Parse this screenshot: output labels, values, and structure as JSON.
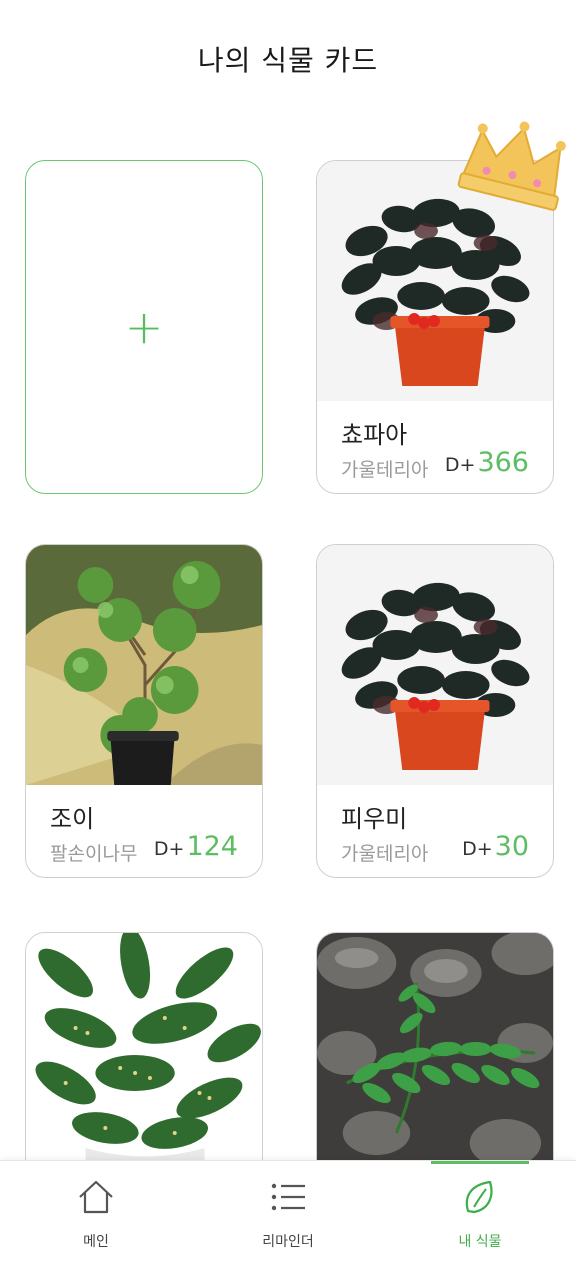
{
  "header": {
    "title": "나의 식물 카드"
  },
  "add_card": {
    "symbol": "+"
  },
  "plants": [
    {
      "nickname": "쵸파아",
      "species": "가울테리아",
      "dday_prefix": "D+",
      "dday_value": "366"
    },
    {
      "nickname": "조이",
      "species": "팔손이나무",
      "dday_prefix": "D+",
      "dday_value": "124"
    },
    {
      "nickname": "피우미",
      "species": "가울테리아",
      "dday_prefix": "D+",
      "dday_value": "30"
    }
  ],
  "tabbar": {
    "items": [
      {
        "label": "메인",
        "icon": "home-icon"
      },
      {
        "label": "리마인더",
        "icon": "list-icon"
      },
      {
        "label": "내 식물",
        "icon": "leaf-icon"
      }
    ],
    "active_index": 2
  },
  "colors": {
    "accent": "#5cbd63",
    "card_border": "#cfcfcf",
    "crown": "#f2c45a"
  }
}
